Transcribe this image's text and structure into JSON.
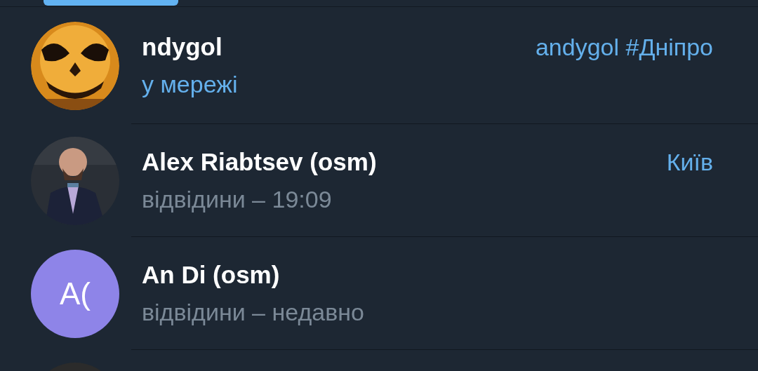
{
  "tabs": [
    {
      "selected": true
    }
  ],
  "contacts": [
    {
      "avatar": {
        "kind": "picture"
      },
      "name": "ndygol",
      "status": "у мережі",
      "online": true,
      "tag": "andygol #Дніпро"
    },
    {
      "avatar": {
        "kind": "picture"
      },
      "name": "Alex Riabtsev (osm)",
      "status": "відвідини – 19:09",
      "online": false,
      "tag": "Київ"
    },
    {
      "avatar": {
        "kind": "letters",
        "letters": "A(",
        "color": "#8e84e8"
      },
      "name": "An Di (osm)",
      "status": "відвідини – недавно",
      "online": false
    },
    {
      "avatar": {
        "kind": "picture"
      }
    }
  ]
}
